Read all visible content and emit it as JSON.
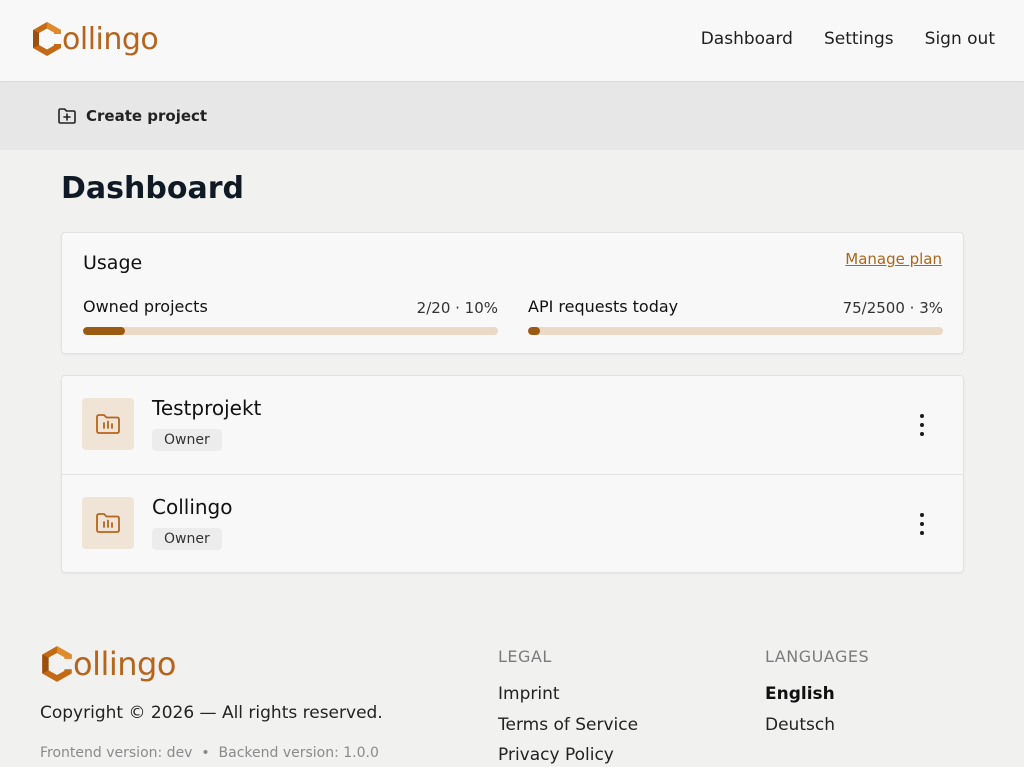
{
  "brand": {
    "name": "ollingo",
    "accent": "#b5651d"
  },
  "nav": {
    "dashboard": "Dashboard",
    "settings": "Settings",
    "signout": "Sign out"
  },
  "toolbar": {
    "create_label": "Create project",
    "create_icon": "folder-plus-icon"
  },
  "page": {
    "title": "Dashboard"
  },
  "usage": {
    "title": "Usage",
    "manage_label": "Manage plan",
    "owned": {
      "label": "Owned projects",
      "value": "2/20 · 10%",
      "percent": 10
    },
    "api": {
      "label": "API requests today",
      "value": "75/2500 · 3%",
      "percent": 3
    }
  },
  "projects": [
    {
      "name": "Testprojekt",
      "role": "Owner",
      "icon": "folder-chart-icon"
    },
    {
      "name": "Collingo",
      "role": "Owner",
      "icon": "folder-chart-icon"
    }
  ],
  "footer": {
    "copyright": "Copyright © 2026 — All rights reserved.",
    "versions": "Frontend version: dev  •  Backend version: 1.0.0",
    "legal_heading": "LEGAL",
    "legal_links": [
      "Imprint",
      "Terms of Service",
      "Privacy Policy"
    ],
    "lang_heading": "LANGUAGES",
    "languages": [
      "English",
      "Deutsch"
    ],
    "active_language": "English"
  }
}
